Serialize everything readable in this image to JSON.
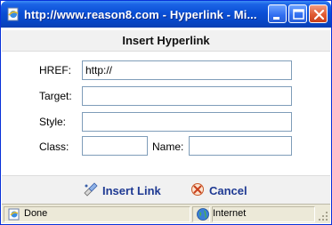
{
  "window": {
    "title": "http://www.reason8.com - Hyperlink - Mi..."
  },
  "dialog": {
    "heading": "Insert Hyperlink"
  },
  "form": {
    "href_label": "HREF:",
    "href_value": "http://",
    "target_label": "Target:",
    "target_value": "",
    "style_label": "Style:",
    "style_value": "",
    "class_label": "Class:",
    "class_value": "",
    "name_label": "Name:",
    "name_value": ""
  },
  "footer": {
    "insert_label": "Insert Link",
    "cancel_label": "Cancel"
  },
  "statusbar": {
    "status": "Done",
    "zone": "Internet"
  },
  "icons": {
    "app": "ie-page-icon",
    "minimize": "minimize-icon",
    "maximize": "maximize-icon",
    "close": "close-icon",
    "insert": "insert-link-icon",
    "cancel": "cancel-icon",
    "done": "page-done-icon",
    "zone": "globe-icon",
    "grip": "resize-grip-icon"
  },
  "colors": {
    "titlebar": "#0a4fd6",
    "link_text": "#1f3a93",
    "input_border": "#7f9db9",
    "close_button": "#e05b33"
  }
}
